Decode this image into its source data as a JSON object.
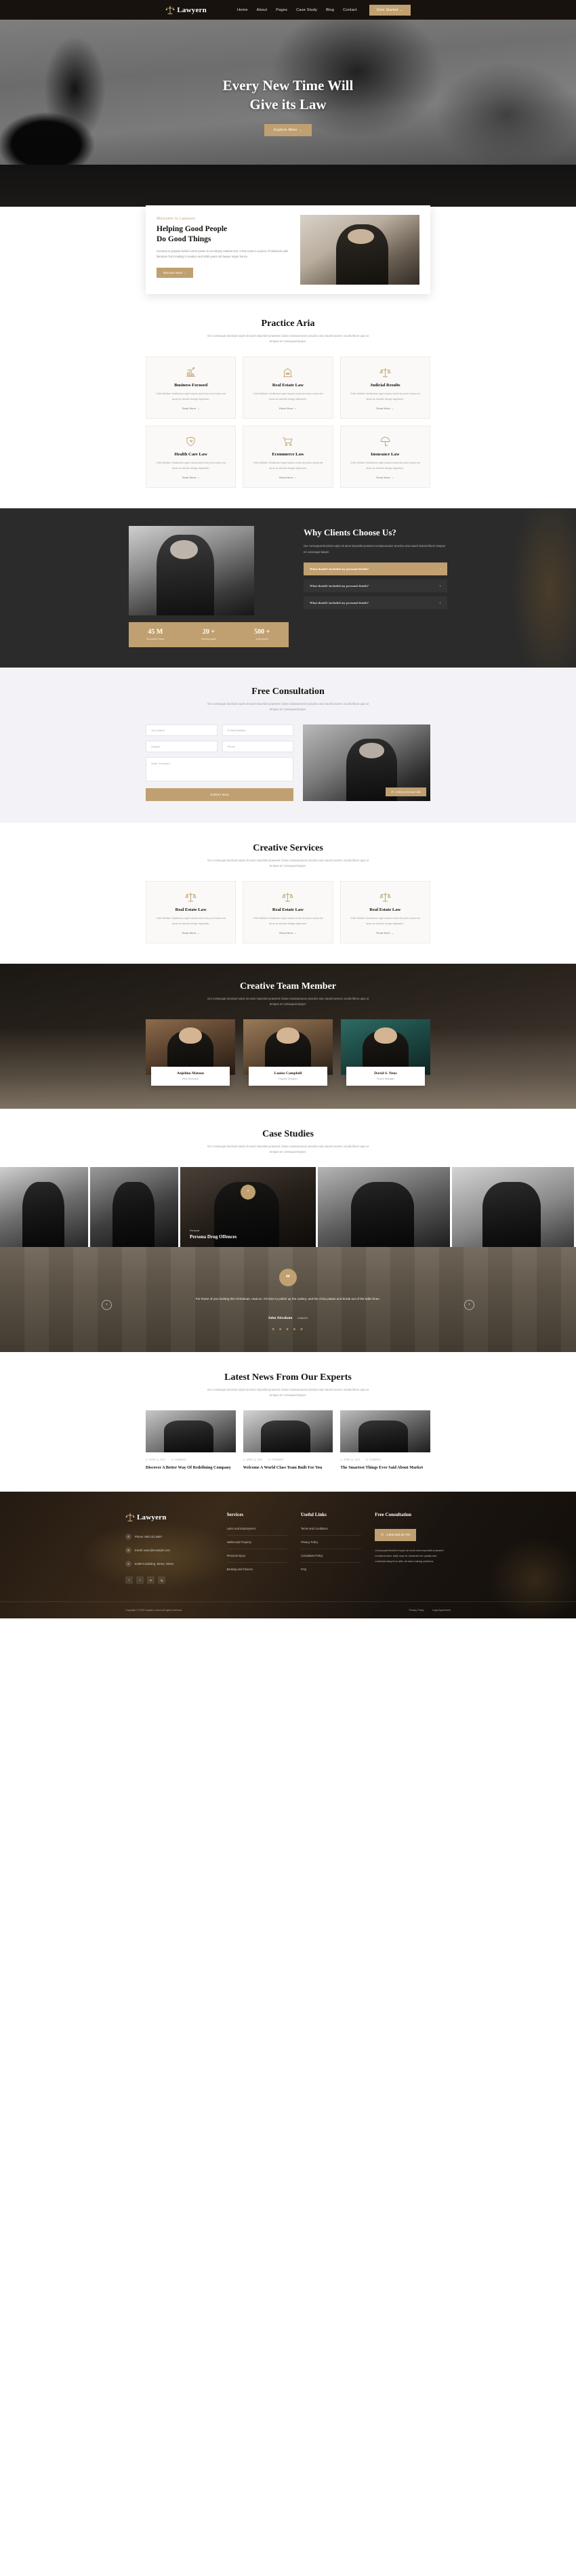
{
  "header": {
    "brand": "Lawyern",
    "nav": [
      {
        "label": "Home"
      },
      {
        "label": "About"
      },
      {
        "label": "Pages"
      },
      {
        "label": "Case Study"
      },
      {
        "label": "Blog"
      },
      {
        "label": "Contact"
      }
    ],
    "cta": "Gete Started  →"
  },
  "hero": {
    "title_line1": "Every New Time Will",
    "title_line2": "Give its Law",
    "button": "Explore More  →"
  },
  "about": {
    "eyebrow": "Welcome to Lawyern",
    "heading_line1": "Helping Good People",
    "heading_line2": "Do Good Things",
    "paragraph": "Contrary to popular belief Lorem Ipsum is not simply random text. It has roots in a piece of classical Latin literature from making it creation and 2000 years old lawyer super hence.",
    "button": "Discover More  →"
  },
  "practice": {
    "title": "Practice Aria",
    "subtitle": "Our consequat tincidunt turpis sit amet imperdiet praesent Class nonatoureanor practice aria mauris laoreet, iaculis libero quis at tempus eri consequat lawyer.",
    "cards": [
      {
        "icon": "chart-bar-icon",
        "title": "Business Focused",
        "desc": "Child Welfare Vestibulum eget mauris world dui proin luctus est lacus ac lobortis design dignissim.",
        "link": "Read More  →"
      },
      {
        "icon": "building-icon",
        "title": "Real Estate Law",
        "desc": "Child Welfare Vestibulum eget mauris world dui proin luctus est lacus ac lobortis design dignissim.",
        "link": "Read More  →"
      },
      {
        "icon": "scales-icon",
        "title": "Judicial Results",
        "desc": "Child Welfare Vestibulum eget mauris world dui proin luctus est lacus ac lobortis design dignissim.",
        "link": "Read More  →"
      },
      {
        "icon": "heart-shield-icon",
        "title": "Health Care Law",
        "desc": "Child Welfare Vestibulum eget mauris world dui proin luctus est lacus ac lobortis design dignissim.",
        "link": "Read More  →"
      },
      {
        "icon": "cart-icon",
        "title": "Ecommerce Law",
        "desc": "Child Welfare Vestibulum eget mauris world dui proin luctus est lacus ac lobortis design dignissim.",
        "link": "Read More  →"
      },
      {
        "icon": "umbrella-icon",
        "title": "Insurance Law",
        "desc": "Child Welfare Vestibulum eget mauris world dui proin luctus est lacus ac lobortis design dignissim.",
        "link": "Read More  →"
      }
    ]
  },
  "why": {
    "title": "Why Clients Choose Us?",
    "paragraph": "Our consequat tincidunt turpis sit amet imperdiet praesent nonatoureanor practice aria mauris laoreet libero tempus eri consequat lawyer.",
    "accordion": [
      {
        "q": "What should i included my personal details?",
        "state": "open",
        "marker": "−"
      },
      {
        "q": "What should i included my personal details?",
        "state": "closed",
        "marker": "+"
      },
      {
        "q": "What should i included my personal details?",
        "state": "closed",
        "marker": "+"
      }
    ],
    "counters": [
      {
        "value": "45 M",
        "label": "Successful Cases"
      },
      {
        "value": "20 +",
        "label": "Winning award"
      },
      {
        "value": "500 +",
        "label": "professional"
      }
    ]
  },
  "consultation": {
    "title": "Free Consultation",
    "subtitle": "Our consequat tincidunt turpis sit amet imperdiet praesent Class nonatoureanor practice aria mauris laoreet, iaculis libero quis at tempus eri consequat lawyer.",
    "fields": [
      {
        "placeholder": "Your Name"
      },
      {
        "placeholder": "E-Mail Address"
      },
      {
        "placeholder": "Subject"
      },
      {
        "placeholder": "Phone"
      }
    ],
    "textarea_placeholder": "Write Comment",
    "submit": "Submit Now",
    "phone_badge": "(+800) 0123 4567 889"
  },
  "services": {
    "title": "Creative Services",
    "subtitle": "Our consequat tincidunt turpis sit amet imperdiet praesent Class nonatoureanor practice aria mauris laoreet, iaculis libero quis at tempus eri consequat lawyer.",
    "cards": [
      {
        "icon": "justice-icon",
        "title": "Real Estate Law",
        "desc": "Child Welfare Vestibulum eget mauris world dui proin luctus est lacus ac lobortis design dignissim.",
        "link": "Read More  →"
      },
      {
        "icon": "justice-icon",
        "title": "Real Estate Law",
        "desc": "Child Welfare Vestibulum eget mauris world dui proin luctus est lacus ac lobortis design dignissim.",
        "link": "Read More  →"
      },
      {
        "icon": "justice-icon",
        "title": "Real Estate Law",
        "desc": "Child Welfare Vestibulum eget mauris world dui proin luctus est lacus ac lobortis design dignissim.",
        "link": "Read More  →"
      }
    ]
  },
  "team": {
    "title": "Creative Team Member",
    "subtitle": "Our consequat tincidunt turpis sit amet imperdiet praesent Class nonatoureanor practice aria mauris laoreet, iaculis libero quis at tempus eri consequat lawyer.",
    "members": [
      {
        "name": "Anjelino Matson",
        "role": "Web Developer"
      },
      {
        "name": "Louise Campbell",
        "role": "Graphic Designer"
      },
      {
        "name": "David S. Neus",
        "role": "Project Manager"
      }
    ]
  },
  "cases": {
    "title": "Case Studies",
    "subtitle": "Our consequat tincidunt turpis sit amet imperdiet praesent Class nonatoureanor practice aria mauris laoreet, iaculis libero quis at tempus eri consequat lawyer.",
    "featured": {
      "tag": "Personal",
      "title": "Persona Drug Offences",
      "badge": "“"
    }
  },
  "testimonial": {
    "quote_mark": "“",
    "text": "For those of you hosting this Christmas, read on. It's time to polish up the cutlery, and the china plates and break out of the table linen.",
    "name": "John Abraham",
    "role": "Customer",
    "stars": "★ ★ ★ ★ ★",
    "prev": "‹",
    "next": "›"
  },
  "news": {
    "title": "Latest News From Our Experts",
    "subtitle": "Our consequat tincidunt turpis sit amet imperdiet praesent Class nonatoureanor practice aria mauris laoreet, iaculis libero quis at tempus eri consequat lawyer.",
    "posts": [
      {
        "date": "APRIL 11, 2023",
        "comment": "COMMENT",
        "title": "Discover A Better Way Of Redefining Company"
      },
      {
        "date": "APRIL 11, 2023",
        "comment": "COMMENT",
        "title": "Welcome A World Class Team Built For You"
      },
      {
        "date": "APRIL 11, 2023",
        "comment": "COMMENT",
        "title": "The Smartest Things Ever Said About Market"
      }
    ]
  },
  "footer": {
    "brand": "Lawyern",
    "contacts": [
      {
        "icon": "phone-icon",
        "text": "Phone: 800.123.4567"
      },
      {
        "icon": "mail-icon",
        "text": "Email: www.@example.com"
      },
      {
        "icon": "pin-icon",
        "text": "618974 Building, Street, Street"
      }
    ],
    "social": [
      "f",
      "t",
      "in",
      "ig"
    ],
    "services": {
      "heading": "Services",
      "items": [
        "Labor and Employment",
        "Intellectual Property",
        "Personal Injury",
        "Banking and Finance"
      ]
    },
    "useful": {
      "heading": "Useful Links",
      "items": [
        "Terms and Conditions",
        "Privacy Policy",
        "Complaints Policy",
        "FAQ"
      ]
    },
    "consult": {
      "heading": "Free Consultation",
      "phone": "1-800-635-28-794",
      "note": "Consequat tincidunt turpis sit amet who imperdiet praesent nonatoureanor daily may be rewarded for quality and understanding from after all start making solutions."
    },
    "copyright": "Copyright © 2023 Lawyern, lorem All rights reserved.",
    "bottom_links": [
      "Privacy Policy",
      "Legal Agreement"
    ]
  }
}
